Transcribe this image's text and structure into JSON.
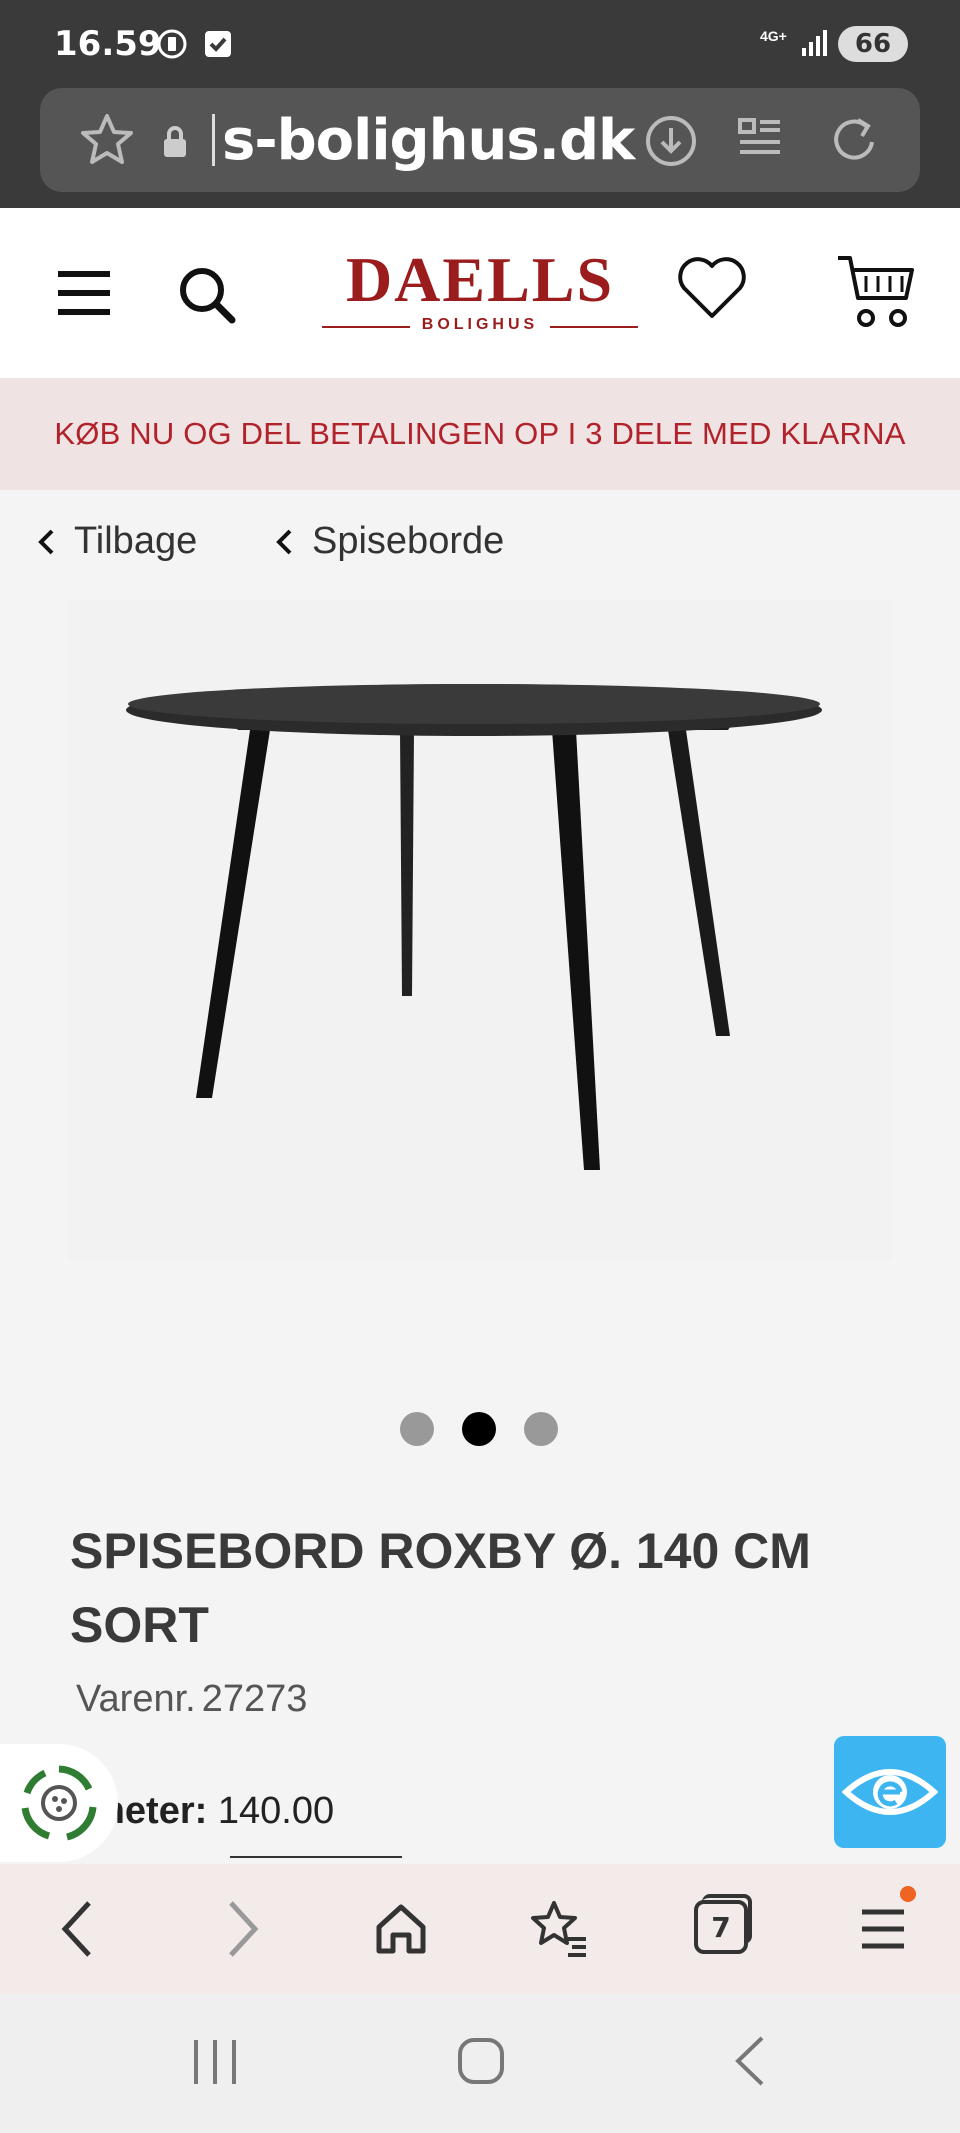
{
  "status_bar": {
    "time": "16.59",
    "network": "4G+",
    "battery": "66"
  },
  "browser": {
    "url": "s-bolighus.dk",
    "tab_count": "7"
  },
  "site": {
    "brand": "DAELLS",
    "brand_sub": "BOLIGHUS",
    "brand_color": "#9b1c1c",
    "banner": "KØB NU OG DEL BETALINGEN OP I 3 DELE MED KLARNA"
  },
  "breadcrumbs": [
    {
      "label": "Tilbage"
    },
    {
      "label": "Spiseborde"
    }
  ],
  "product": {
    "title": "SPISEBORD ROXBY Ø. 140 CM SORT",
    "sku_label": "Varenr.",
    "sku": "27273",
    "spec_label": "ameter:",
    "spec_value": "140.00",
    "image_icon": "dining-table-image",
    "carousel": {
      "count": 3,
      "active": 2
    }
  },
  "icons": {
    "menu": "hamburger-icon",
    "search": "search-icon",
    "wishlist": "heart-icon",
    "cart": "cart-icon",
    "accessibility": "eye-icon",
    "sustainability": "recycle-icon"
  }
}
